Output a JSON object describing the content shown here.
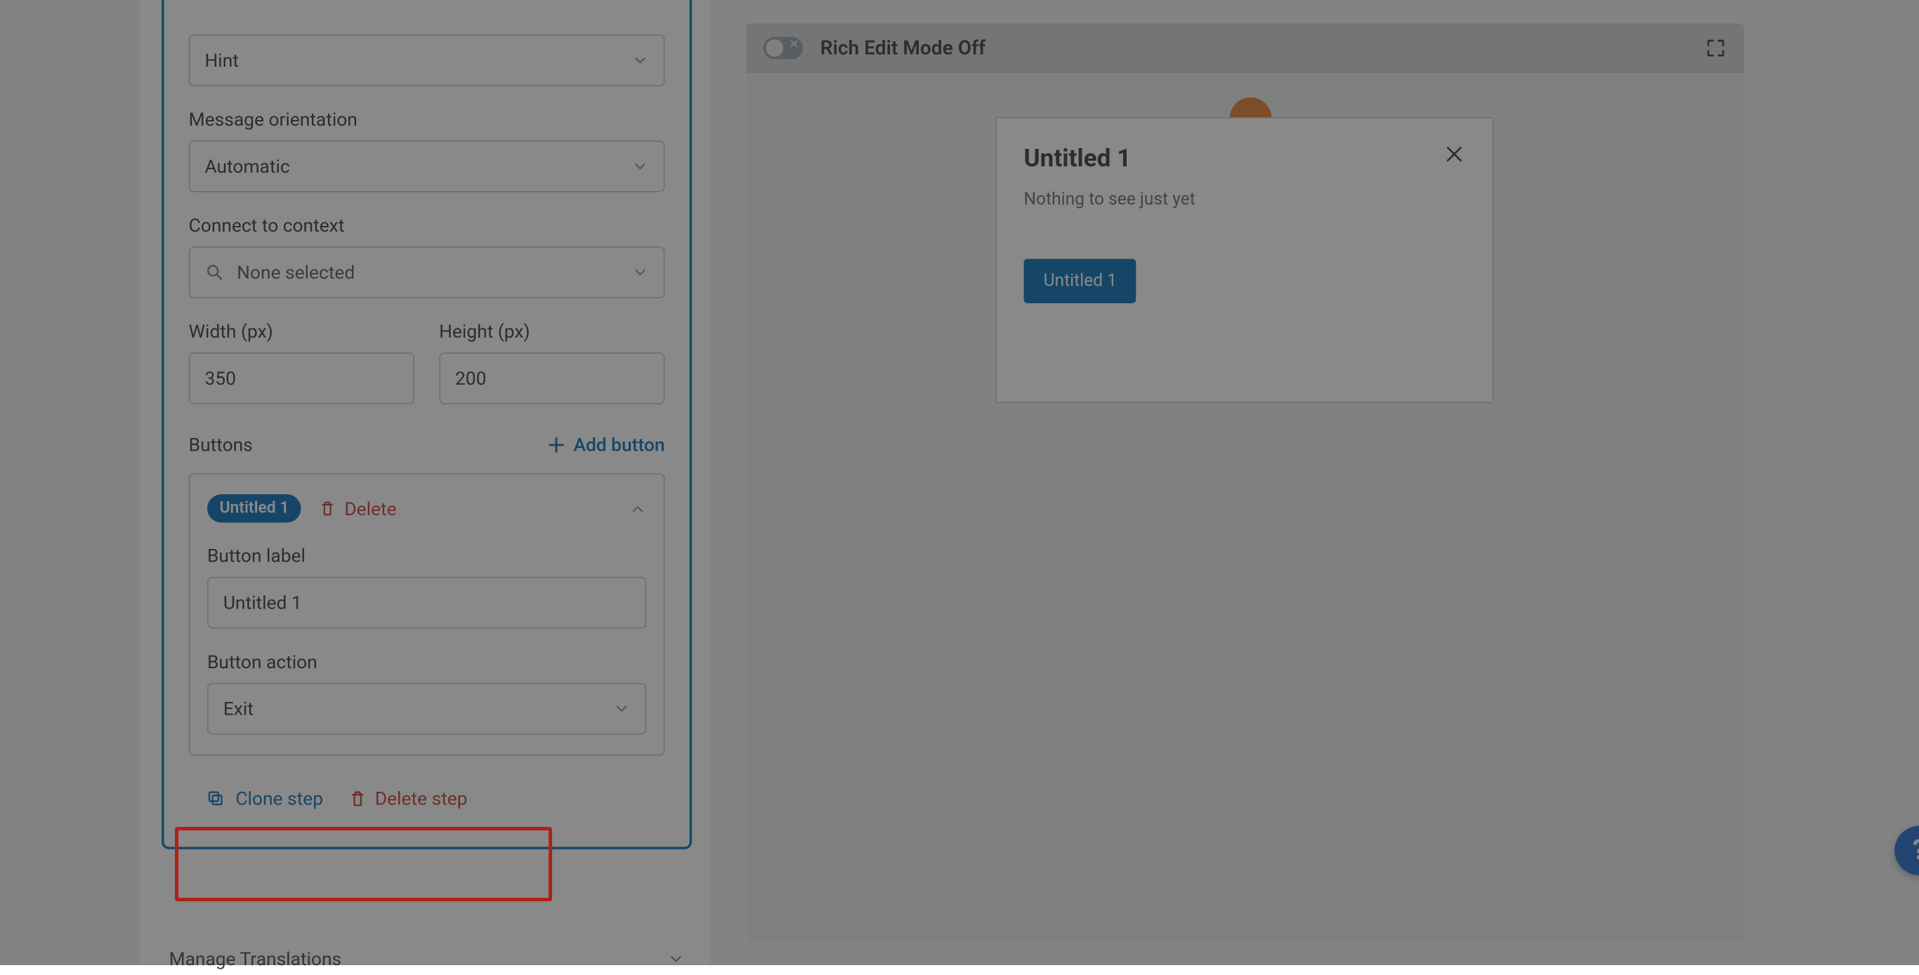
{
  "panel": {
    "hint_select_value": "Hint",
    "orientation_label": "Message orientation",
    "orientation_value": "Automatic",
    "context_label": "Connect to context",
    "context_value": "None selected",
    "width_label": "Width (px)",
    "width_value": "350",
    "height_label": "Height (px)",
    "height_value": "200",
    "buttons_label": "Buttons",
    "add_button_label": "Add button",
    "button_item": {
      "chip": "Untitled 1",
      "delete_label": "Delete",
      "label_field": "Button label",
      "label_value": "Untitled 1",
      "action_field": "Button action",
      "action_value": "Exit"
    },
    "clone_step_label": "Clone step",
    "delete_step_label": "Delete step",
    "manage_translations": "Manage Translations"
  },
  "preview": {
    "toolbar_title": "Rich Edit Mode Off",
    "tooltip_title": "Untitled 1",
    "tooltip_body": "Nothing to see just yet",
    "tooltip_button": "Untitled 1"
  },
  "help": {
    "glyph": "?"
  }
}
